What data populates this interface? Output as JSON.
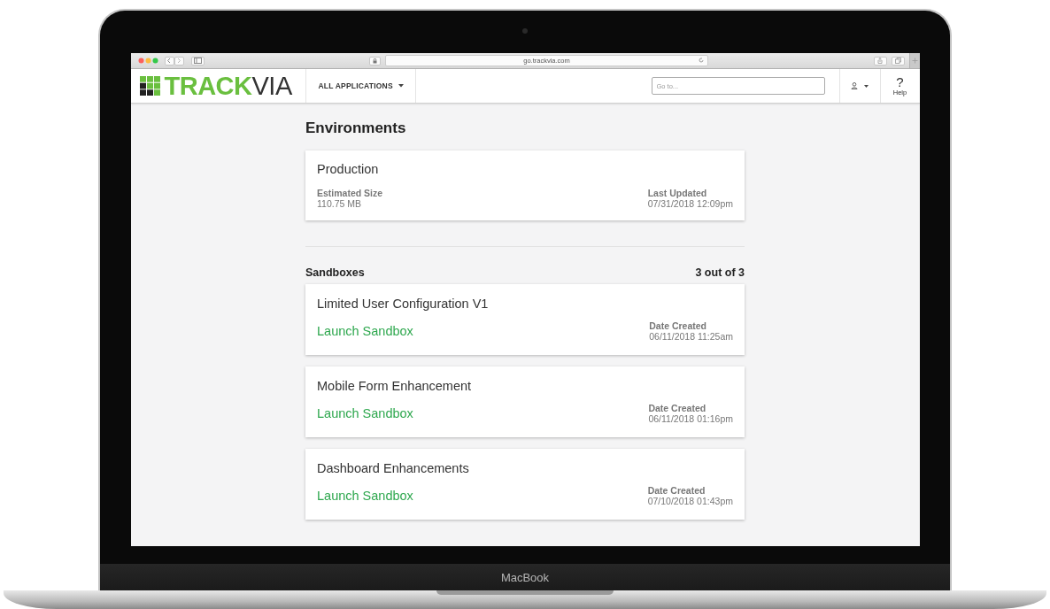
{
  "device": {
    "label": "MacBook"
  },
  "browser": {
    "url": "go.trackvia.com"
  },
  "header": {
    "logo": [
      {
        "text": "TRACK",
        "color": "#6abf3f"
      },
      {
        "text": "VIA",
        "color": "#333333"
      }
    ],
    "app_menu": "ALL APPLICATIONS",
    "search": {
      "placeholder": "Go to..."
    },
    "help": {
      "icon_text": "?",
      "label": "Help"
    }
  },
  "page": {
    "title": "Environments",
    "production": {
      "name": "Production",
      "fields": [
        {
          "label": "Estimated Size",
          "value": "110.75 MB"
        },
        {
          "label": "Last Updated",
          "value": "07/31/2018 12:09pm"
        }
      ]
    },
    "sandboxes": {
      "title": "Sandboxes",
      "count": "3 out of 3",
      "items": [
        {
          "name": "Limited User Configuration V1",
          "action": "Launch Sandbox",
          "date_label": "Date Created",
          "date": "06/11/2018 11:25am"
        },
        {
          "name": "Mobile Form Enhancement",
          "action": "Launch Sandbox",
          "date_label": "Date Created",
          "date": "06/11/2018 01:16pm"
        },
        {
          "name": "Dashboard Enhancements",
          "action": "Launch Sandbox",
          "date_label": "Date Created",
          "date": "07/10/2018 01:43pm"
        }
      ]
    }
  }
}
